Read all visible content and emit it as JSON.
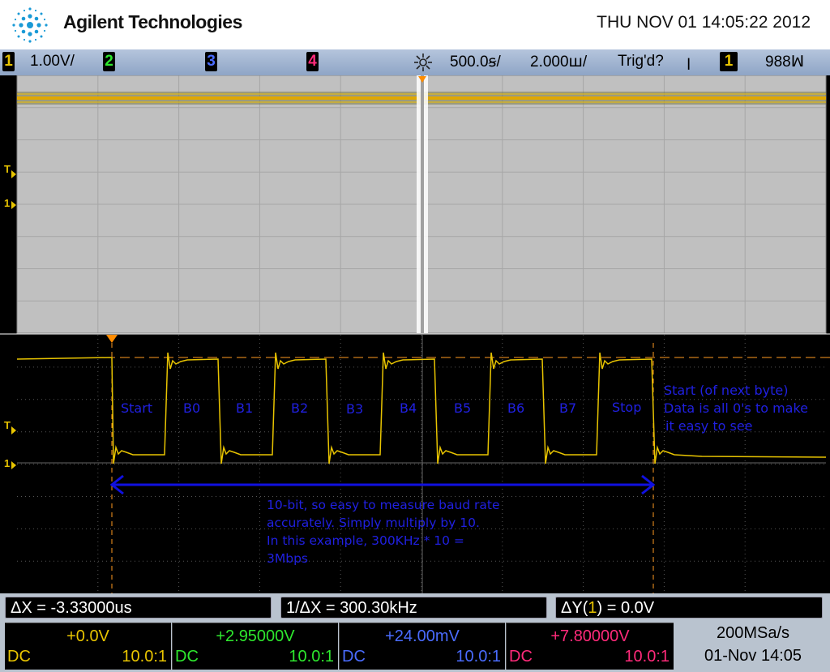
{
  "header": {
    "brand": "Agilent Technologies",
    "datetime": "THU NOV 01 14:05:22 2012"
  },
  "statusbar": {
    "ch1_scale": "1.00V/",
    "ch_labels": [
      "1",
      "2",
      "3",
      "4"
    ],
    "time_per_div": "500.0ꞩ/",
    "zoom_per_div": "2.000ꟺ/",
    "trig_status": "Trig'd?",
    "trig_slope": "ꞁ",
    "trig_source": "1",
    "trig_level": "988ꟽ"
  },
  "colors": {
    "ch1": "#e8c400",
    "ch2": "#2ee82e",
    "ch3": "#4a6cff",
    "ch4": "#ff2a7a",
    "annotation": "#2020e0"
  },
  "screen": {
    "markers": {
      "trigger_level": "T",
      "ch1_ground": "1"
    },
    "annotations": {
      "bits": [
        "Start",
        "B0",
        "B1",
        "B2",
        "B3",
        "B4",
        "B5",
        "B6",
        "B7",
        "Stop"
      ],
      "next_byte": [
        "Start (of next byte)",
        "Data is all 0's to make",
        "it easy to see"
      ],
      "baud_note": [
        "10-bit, so easy to measure baud rate",
        "accurately.  Simply multiply by 10.",
        "In this example, 300KHz * 10 =",
        "3Mbps"
      ]
    }
  },
  "measurements": {
    "delta_x": "ΔX = -3.33000us",
    "inv_delta_x": "1/ΔX = 300.30kHz",
    "delta_y_prefix": "ΔY(",
    "delta_y_src": "1",
    "delta_y_suffix": ") = 0.0V"
  },
  "channels": [
    {
      "offset": "+0.0V",
      "coupling": "DC",
      "probe": "10.0:1"
    },
    {
      "offset": "+2.95000V",
      "coupling": "DC",
      "probe": "10.0:1"
    },
    {
      "offset": "+24.00mV",
      "coupling": "DC",
      "probe": "10.0:1"
    },
    {
      "offset": "+7.80000V",
      "coupling": "DC",
      "probe": "10.0:1"
    }
  ],
  "acquisition": {
    "sample_rate": "200MSa/s",
    "timestamp": "01-Nov 14:05"
  }
}
